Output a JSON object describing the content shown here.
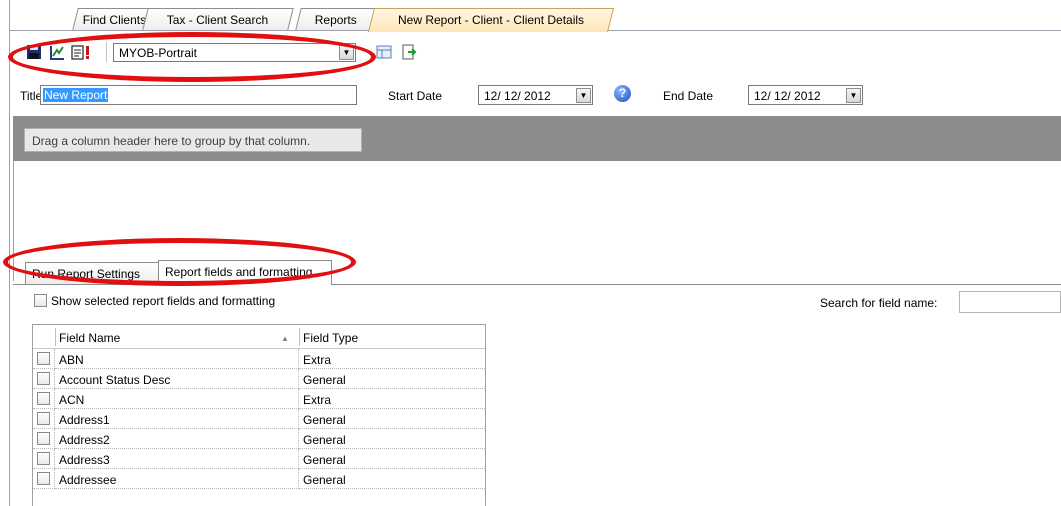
{
  "tabs": [
    {
      "label": "Find Clients"
    },
    {
      "label": "Tax - Client Search"
    },
    {
      "label": "Reports"
    },
    {
      "label": "New Report - Client - Client Details",
      "active": true
    }
  ],
  "toolbar": {
    "icons": [
      "save-icon",
      "edit-report-icon",
      "run-report-icon",
      "layout-icon",
      "export-icon"
    ],
    "template_value": "MYOB-Portrait"
  },
  "form": {
    "title_label": "Title",
    "title_value": "New Report",
    "start_date_label": "Start Date",
    "start_date_value": "12/ 12/ 2012",
    "end_date_label": "End Date",
    "end_date_value": "12/ 12/ 2012",
    "help_glyph": "?"
  },
  "group_panel": {
    "hint": "Drag a column header here to group by that column."
  },
  "sub_tabs": [
    {
      "label": "Run Report Settings"
    },
    {
      "label": "Report fields and formatting",
      "active": true
    }
  ],
  "fields_panel": {
    "show_selected_label": "Show selected report fields and formatting",
    "search_label": "Search for field name:",
    "search_value": ""
  },
  "grid": {
    "columns": [
      "Field Name",
      "Field Type"
    ],
    "rows": [
      {
        "name": "ABN",
        "type": "Extra"
      },
      {
        "name": "Account Status Desc",
        "type": "General"
      },
      {
        "name": "ACN",
        "type": "Extra"
      },
      {
        "name": "Address1",
        "type": "General"
      },
      {
        "name": "Address2",
        "type": "General"
      },
      {
        "name": "Address3",
        "type": "General"
      },
      {
        "name": "Addressee",
        "type": "General"
      }
    ]
  },
  "colors": {
    "annotation": "#e01010",
    "selection": "#3399ff",
    "group_panel": "#8c8c8c",
    "active_tab": "#fde6b7"
  }
}
